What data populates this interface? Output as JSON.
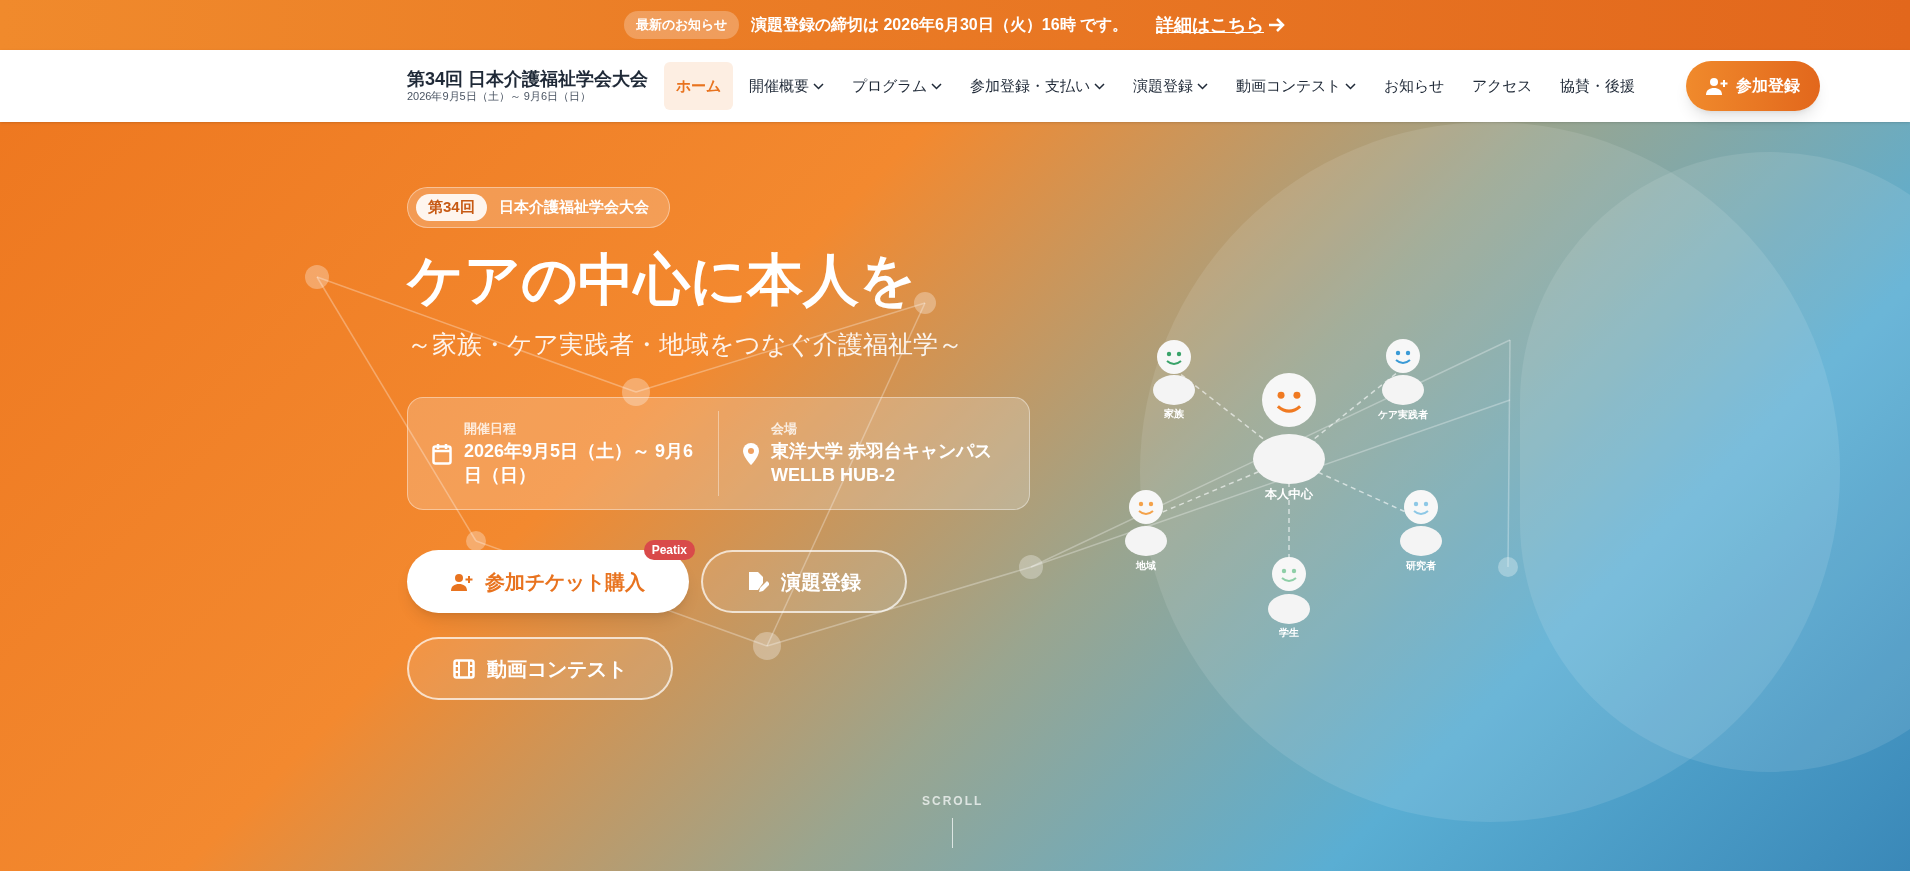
{
  "announcement": {
    "badge": "最新のお知らせ",
    "message": "演題登録の締切は 2026年6月30日（火）16時 です。",
    "link": "詳細はこちら"
  },
  "header": {
    "title": "第34回 日本介護福祉学会大会",
    "dates": "2026年9月5日（土）～ 9月6日（日）",
    "nav": [
      {
        "label": "ホーム",
        "selected": true,
        "dropdown": false
      },
      {
        "label": "開催概要",
        "selected": false,
        "dropdown": true
      },
      {
        "label": "プログラム",
        "selected": false,
        "dropdown": true
      },
      {
        "label": "参加登録・支払い",
        "selected": false,
        "dropdown": true
      },
      {
        "label": "演題登録",
        "selected": false,
        "dropdown": true
      },
      {
        "label": "動画コンテスト",
        "selected": false,
        "dropdown": true
      },
      {
        "label": "お知らせ",
        "selected": false,
        "dropdown": false
      },
      {
        "label": "アクセス",
        "selected": false,
        "dropdown": false
      },
      {
        "label": "協賛・後援",
        "selected": false,
        "dropdown": false
      }
    ],
    "cta": "参加登録"
  },
  "hero": {
    "edition": "第34回",
    "event_name": "日本介護福祉学会大会",
    "title": "ケアの中心に本人を",
    "subtitle": "～家族・ケア実践者・地域をつなぐ介護福祉学～",
    "info": [
      {
        "kind": "date",
        "label": "開催日程",
        "value": "2026年9月5日（土）～ 9月6日（日）"
      },
      {
        "kind": "venue",
        "label": "会場",
        "value": "東洋大学 赤羽台キャンパス WELLB HUB-2"
      }
    ],
    "buttons": [
      {
        "kind": "ticket",
        "label": "参加チケット購入",
        "badge": "Peatix",
        "primary": true
      },
      {
        "kind": "abstract",
        "label": "演題登録",
        "primary": false
      },
      {
        "kind": "video",
        "label": "動画コンテスト",
        "primary": false
      }
    ],
    "scroll": "SCROLL"
  },
  "diagram": {
    "people": [
      {
        "label": "本人中心",
        "color": "#f07a22"
      },
      {
        "label": "家族",
        "color": "#3aa36a"
      },
      {
        "label": "ケア実践者",
        "color": "#3a9ad6"
      },
      {
        "label": "地域",
        "color": "#f4a24a"
      },
      {
        "label": "研究者",
        "color": "#8ec8e6"
      },
      {
        "label": "学生",
        "color": "#8fcfa8"
      }
    ]
  }
}
